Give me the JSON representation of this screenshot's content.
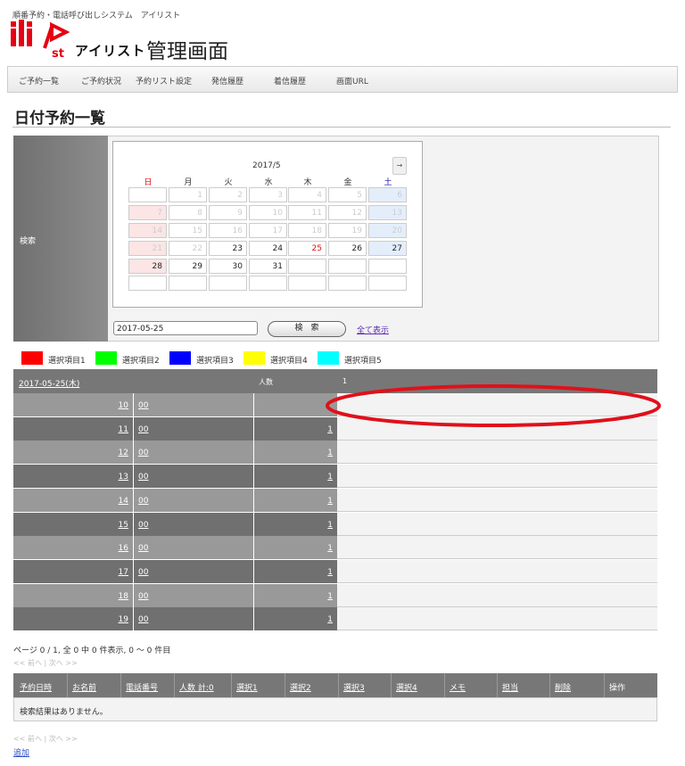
{
  "header": {
    "tagline": "順番予約・電話呼び出しシステム　アイリスト",
    "brand_kana": "アイリスト",
    "title": "管理画面"
  },
  "nav": [
    "ご予約一覧",
    "ご予約状況",
    "予約リスト設定",
    "発信履歴",
    "着信履歴",
    "画面URL"
  ],
  "page_title": "日付予約一覧",
  "search": {
    "label": "検索",
    "calendar": {
      "month": "2017/5",
      "next": "→",
      "weekdays": [
        "日",
        "月",
        "火",
        "水",
        "木",
        "金",
        "土"
      ],
      "rows": [
        [
          "",
          "1",
          "2",
          "3",
          "4",
          "5",
          "6"
        ],
        [
          "7",
          "8",
          "9",
          "10",
          "11",
          "12",
          "13"
        ],
        [
          "14",
          "15",
          "16",
          "17",
          "18",
          "19",
          "20"
        ],
        [
          "21",
          "22",
          "23",
          "24",
          "25",
          "26",
          "27"
        ],
        [
          "28",
          "29",
          "30",
          "31",
          "",
          "",
          ""
        ],
        [
          "",
          "",
          "",
          "",
          "",
          "",
          ""
        ]
      ],
      "today": "25",
      "first_active_day": 23
    },
    "date_value": "2017-05-25",
    "search_button": "検　索",
    "show_all": "全て表示"
  },
  "legend": [
    {
      "label": "選択項目1",
      "color": "#ff0000"
    },
    {
      "label": "選択項目2",
      "color": "#00ff00"
    },
    {
      "label": "選択項目3",
      "color": "#0000ff"
    },
    {
      "label": "選択項目4",
      "color": "#ffff00"
    },
    {
      "label": "選択項目5",
      "color": "#00ffff"
    }
  ],
  "schedule": {
    "date": "2017-05-25(木)",
    "count_header": "人数",
    "slot_header": "1",
    "rows": [
      {
        "hour": "10",
        "min": "00",
        "count": ""
      },
      {
        "hour": "11",
        "min": "00",
        "count": "1"
      },
      {
        "hour": "12",
        "min": "00",
        "count": "1"
      },
      {
        "hour": "13",
        "min": "00",
        "count": "1"
      },
      {
        "hour": "14",
        "min": "00",
        "count": "1"
      },
      {
        "hour": "15",
        "min": "00",
        "count": "1"
      },
      {
        "hour": "16",
        "min": "00",
        "count": "1"
      },
      {
        "hour": "17",
        "min": "00",
        "count": "1"
      },
      {
        "hour": "18",
        "min": "00",
        "count": "1"
      },
      {
        "hour": "19",
        "min": "00",
        "count": "1"
      }
    ]
  },
  "results": {
    "paging_text": "ページ 0 / 1, 全 0 中 0 件表示, 0 ～ 0 件目",
    "pager": "<< 前へ | 次へ >>",
    "columns": [
      "予約日時",
      "お名前",
      "電話番号",
      "人数 計:0",
      "選択1",
      "選択2",
      "選択3",
      "選択4",
      "メモ",
      "担当",
      "削除",
      "操作"
    ],
    "empty_message": "検索結果はありません。",
    "add_link": "追加"
  },
  "colors": {
    "logo_red": "#e60012",
    "annotation_red": "#e0101a"
  }
}
